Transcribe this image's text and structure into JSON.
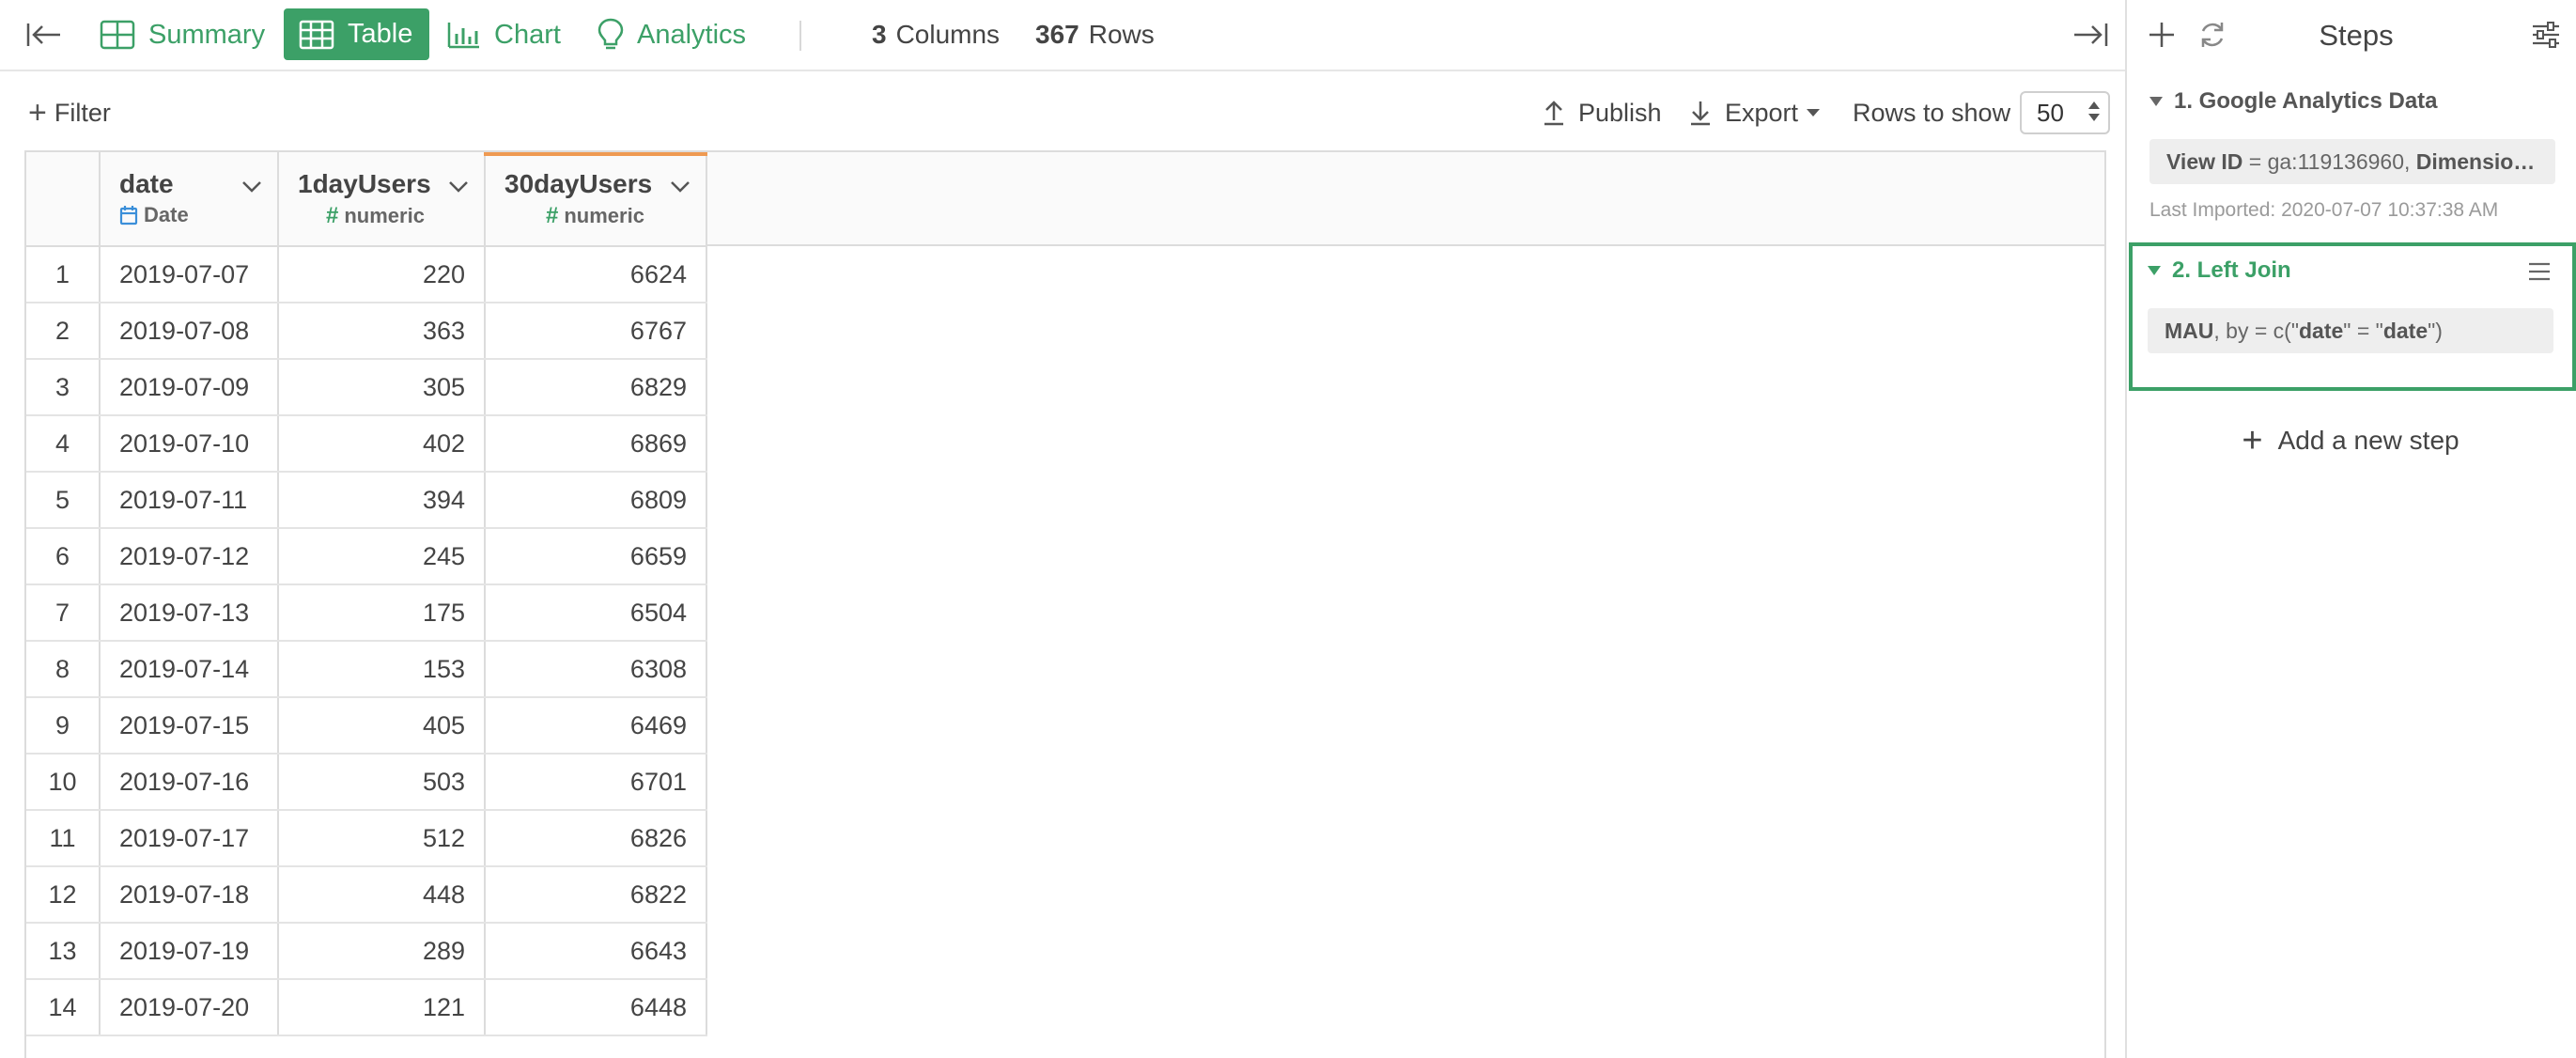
{
  "topbar": {
    "tabs": [
      {
        "label": "Summary",
        "icon": "summary-icon"
      },
      {
        "label": "Table",
        "icon": "table-icon",
        "active": true
      },
      {
        "label": "Chart",
        "icon": "bar-chart-icon"
      },
      {
        "label": "Analytics",
        "icon": "lightbulb-icon"
      }
    ],
    "columns_count": "3",
    "columns_label": "Columns",
    "rows_count": "367",
    "rows_label": "Rows"
  },
  "toolbar": {
    "filter_label": "Filter",
    "publish_label": "Publish",
    "export_label": "Export",
    "rows_to_show_label": "Rows to show",
    "rows_to_show_value": "50"
  },
  "table": {
    "columns": [
      {
        "name": "date",
        "type": "Date"
      },
      {
        "name": "1dayUsers",
        "type": "numeric"
      },
      {
        "name": "30dayUsers",
        "type": "numeric"
      }
    ],
    "rows": [
      {
        "idx": "1",
        "date": "2019-07-07",
        "day": "220",
        "month": "6624"
      },
      {
        "idx": "2",
        "date": "2019-07-08",
        "day": "363",
        "month": "6767"
      },
      {
        "idx": "3",
        "date": "2019-07-09",
        "day": "305",
        "month": "6829"
      },
      {
        "idx": "4",
        "date": "2019-07-10",
        "day": "402",
        "month": "6869"
      },
      {
        "idx": "5",
        "date": "2019-07-11",
        "day": "394",
        "month": "6809"
      },
      {
        "idx": "6",
        "date": "2019-07-12",
        "day": "245",
        "month": "6659"
      },
      {
        "idx": "7",
        "date": "2019-07-13",
        "day": "175",
        "month": "6504"
      },
      {
        "idx": "8",
        "date": "2019-07-14",
        "day": "153",
        "month": "6308"
      },
      {
        "idx": "9",
        "date": "2019-07-15",
        "day": "405",
        "month": "6469"
      },
      {
        "idx": "10",
        "date": "2019-07-16",
        "day": "503",
        "month": "6701"
      },
      {
        "idx": "11",
        "date": "2019-07-17",
        "day": "512",
        "month": "6826"
      },
      {
        "idx": "12",
        "date": "2019-07-18",
        "day": "448",
        "month": "6822"
      },
      {
        "idx": "13",
        "date": "2019-07-19",
        "day": "289",
        "month": "6643"
      },
      {
        "idx": "14",
        "date": "2019-07-20",
        "day": "121",
        "month": "6448"
      }
    ]
  },
  "panel": {
    "title": "Steps",
    "steps": [
      {
        "title": "1. Google Analytics Data",
        "detail_key": "View ID",
        "detail_rest": " = ga:119136960, ",
        "detail_key2": "Dimensio…",
        "meta": "Last Imported: 2020-07-07 10:37:38 AM"
      },
      {
        "title": "2. Left Join",
        "detail_key": "MAU",
        "detail_mid": ", by = c(\"",
        "detail_key2": "date",
        "detail_eq": "\" = \"",
        "detail_key3": "date",
        "detail_end": "\")"
      }
    ],
    "add_step_label": "Add a new step"
  },
  "colors": {
    "accent_green": "#3ca067",
    "column_highlight": "#ef9a52",
    "date_icon_blue": "#3b8fd9"
  }
}
